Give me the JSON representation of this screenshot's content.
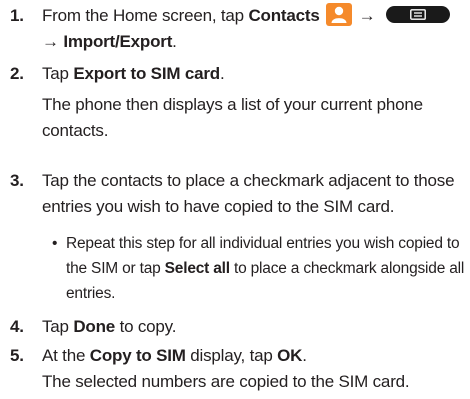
{
  "steps": [
    {
      "number": "1.",
      "prefix": "From the Home screen, tap ",
      "contacts_label": "Contacts",
      "arrow1": " → ",
      "line2": "→ Import/Export",
      "line2_end": "."
    },
    {
      "number": "2.",
      "prefix": "Tap ",
      "bold": "Export to SIM card",
      "suffix": ".",
      "note_line1": "The phone then displays a list of your current phone",
      "note_line2": "contacts."
    },
    {
      "number": "3.",
      "line1": "Tap the contacts to place a checkmark adjacent to those",
      "line2": "entries you wish to have copied to the SIM card."
    },
    {
      "number": "4.",
      "prefix": "Tap ",
      "bold": "Done",
      "suffix": " to copy."
    },
    {
      "number": "5.",
      "prefix": "At the ",
      "bold1": "Copy to SIM",
      "middle": " display, tap ",
      "bold2": "OK",
      "suffix": ".",
      "note": "The selected numbers are copied to the SIM card."
    }
  ],
  "substep": {
    "bullet": "•",
    "line1": "Repeat this step for all individual entries you wish copied to",
    "line2_prefix": "the SIM or tap ",
    "line2_bold": "Select all",
    "line2_suffix": " to place a checkmark alongside all",
    "line3": "entries."
  },
  "icons": {
    "contacts": "contacts-person-icon",
    "menu": "menu-key-icon",
    "contacts_icon_color": "#f58a2b"
  }
}
